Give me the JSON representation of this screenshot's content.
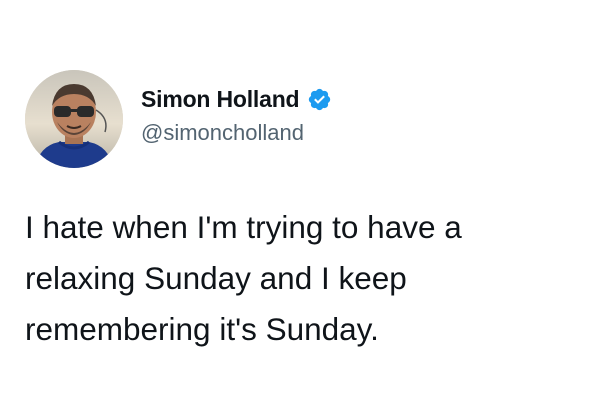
{
  "tweet": {
    "author": {
      "display_name": "Simon Holland",
      "handle": "@simoncholland",
      "verified": true,
      "avatar_icon": "profile-photo",
      "verified_icon": "verified-badge-icon",
      "verified_color": "#1d9bf0"
    },
    "text_lines": [
      "I hate when I'm trying to have a",
      "relaxing Sunday and I keep",
      "remembering it's Sunday."
    ]
  }
}
